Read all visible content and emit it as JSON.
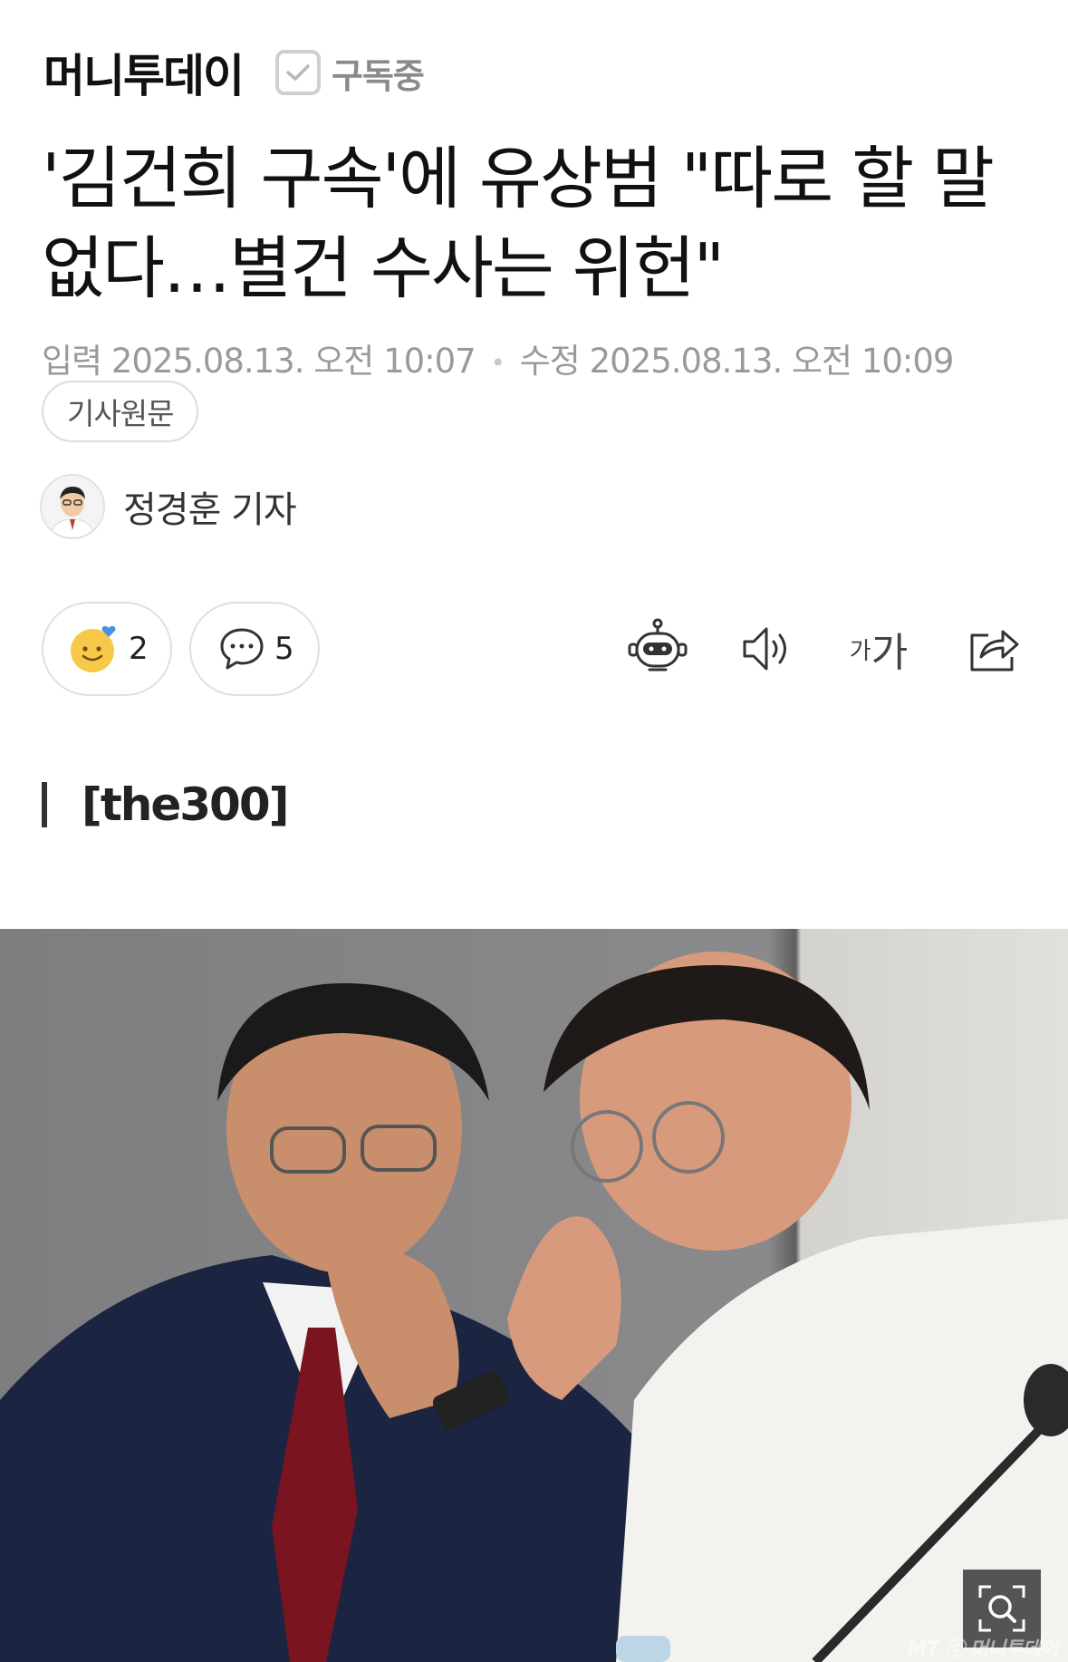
{
  "publisher": {
    "name": "머니투데이",
    "subscribe_label": "구독중"
  },
  "article": {
    "title_line1": "'김건희 구속'에 유상범 \"따로 할 말",
    "title_line2": "없다…별건 수사는 위헌\"",
    "input_label": "입력",
    "input_date": "2025.08.13. 오전 10:07",
    "modified_label": "수정",
    "modified_date": "2025.08.13. 오전 10:09",
    "original_button": "기사원문",
    "reporter": "정경훈 기자",
    "section": "[the300]"
  },
  "actions": {
    "reaction_count": "2",
    "comment_count": "5",
    "font_size_small": "가",
    "font_size_big": "가"
  },
  "photo": {
    "watermark": "MT ⓒ 머니투데이"
  },
  "colors": {
    "text": "#111111",
    "muted": "#9a9a9a",
    "border": "#e0e0e0",
    "emoji_yellow": "#f7c948",
    "heart_blue": "#4a90e2"
  }
}
